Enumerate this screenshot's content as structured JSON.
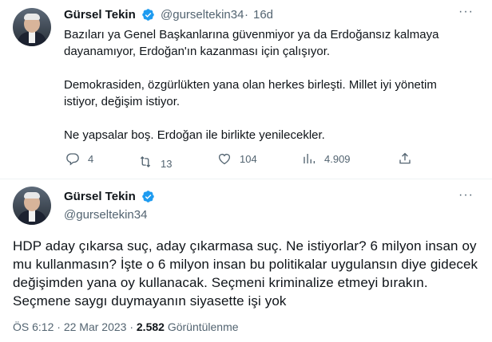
{
  "reply_tweet": {
    "author_name": "Gürsel Tekin",
    "handle": "@gurseltekin34",
    "separator": "·",
    "time": "16d",
    "text": "Bazıları ya Genel Başkanlarına güvenmiyor ya da Erdoğansız kalmaya\ndayanamıyor, Erdoğan'ın kazanması için çalışıyor.\n\nDemokrasiden, özgürlükten yana olan herkes birleşti. Millet iyi yönetim\nistiyor, değişim istiyor.\n\nNe yapsalar boş. Erdoğan ile birlikte yenilecekler.",
    "actions": {
      "replies": "4",
      "retweets": "13",
      "likes": "104",
      "views": "4.909"
    }
  },
  "main_tweet": {
    "author_name": "Gürsel Tekin",
    "handle": "@gurseltekin34",
    "text": "HDP aday çıkarsa suç, aday çıkarmasa suç. Ne istiyorlar? 6 milyon insan oy mu kullanmasın? İşte o 6 milyon insan bu politikalar uygulansın diye gidecek değişimden yana oy kullanacak. Seçmeni kriminalize etmeyi bırakın. Seçmene saygı duymayanın siyasette işi yok",
    "time": "ÖS 6:12",
    "separator": "·",
    "date": "22 Mar 2023",
    "views_count": "2.582",
    "views_label": "Görüntülenme"
  },
  "more_menu_glyph": "···",
  "colors": {
    "verified": "#1d9bf0",
    "text": "#0f1419",
    "secondary": "#536471",
    "divider": "#eff3f4"
  },
  "icons": [
    "reply-icon",
    "retweet-icon",
    "like-icon",
    "views-icon",
    "share-icon",
    "verified-badge-icon",
    "more-icon"
  ]
}
